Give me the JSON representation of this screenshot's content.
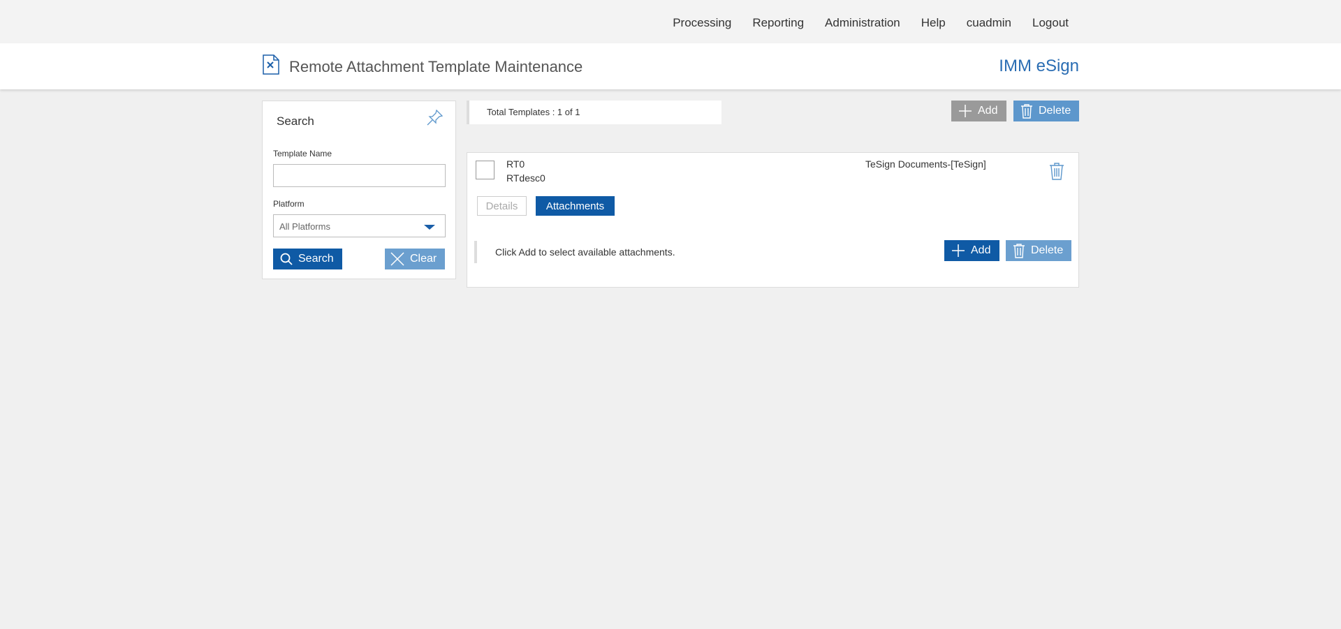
{
  "nav": {
    "items": [
      "Processing",
      "Reporting",
      "Administration",
      "Help",
      "cuadmin",
      "Logout"
    ]
  },
  "header": {
    "title": "Remote Attachment Template Maintenance",
    "brand": "IMM eSign"
  },
  "search": {
    "title": "Search",
    "template_name_label": "Template Name",
    "template_name_value": "",
    "platform_label": "Platform",
    "platform_value": "All Platforms",
    "search_button": "Search",
    "clear_button": "Clear"
  },
  "results": {
    "total_text": "Total Templates : 1 of 1",
    "add_button": "Add",
    "delete_button": "Delete"
  },
  "template": {
    "name": "RT0",
    "description": "RTdesc0",
    "platform": "TeSign Documents-[TeSign]",
    "tabs": [
      "Details",
      "Attachments"
    ],
    "active_tab": "Attachments",
    "attachments_message": "Click Add to select available attachments.",
    "add_button": "Add",
    "delete_button": "Delete"
  },
  "colors": {
    "primary": "#0f5aa5",
    "primary_light": "#6b9fcf",
    "disabled": "#9a9a9a",
    "brand": "#2a6db3"
  },
  "icons": [
    "document-x-icon",
    "pin-icon",
    "search-icon",
    "close-icon",
    "plus-icon",
    "trash-icon",
    "chevron-down-icon"
  ]
}
